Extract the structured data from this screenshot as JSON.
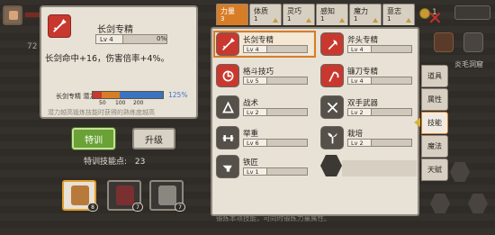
{
  "hud": {
    "level_text": "72",
    "gold_text": "1",
    "right_note": "炎毛洞窟"
  },
  "detail": {
    "title": "长剑专精",
    "level": "Lv 4",
    "progress_pct": "0%",
    "description": "长剑命中+16，伤害倍率+4%。",
    "mastery_label": "长剑专精 潜力",
    "mastery_ticks": [
      "50",
      "100",
      "200"
    ],
    "mastery_pct": "125%",
    "mastery_note": "潜力越高锻炼技能时获得的熟练度越高",
    "icon": "sword-icon"
  },
  "buttons": {
    "train": "特训",
    "upgrade": "升级"
  },
  "skill_points": {
    "label": "特训技能点:",
    "value": "23"
  },
  "portraits": [
    {
      "badge": "8"
    },
    {
      "badge": "7"
    },
    {
      "badge": "7"
    }
  ],
  "tabs": [
    {
      "label": "力量",
      "count": "3",
      "active": true
    },
    {
      "label": "体质",
      "count": "1"
    },
    {
      "label": "灵巧",
      "count": "1"
    },
    {
      "label": "感知",
      "count": "1"
    },
    {
      "label": "魔力",
      "count": "1"
    },
    {
      "label": "意志",
      "count": "1"
    }
  ],
  "skills": [
    {
      "name": "长剑专精",
      "level": "Lv 4",
      "icon": "sword-icon",
      "color": "#c9382e"
    },
    {
      "name": "斧头专精",
      "level": "Lv 4",
      "icon": "axe-icon",
      "color": "#c9382e"
    },
    {
      "name": "格斗技巧",
      "level": "Lv 5",
      "icon": "fist-icon",
      "color": "#c9382e"
    },
    {
      "name": "镰刀专精",
      "level": "Lv 4",
      "icon": "scythe-icon",
      "color": "#c9382e"
    },
    {
      "name": "战术",
      "level": "Lv 2",
      "icon": "tactics-icon",
      "color": "#55504a"
    },
    {
      "name": "双手武器",
      "level": "Lv 2",
      "icon": "two-hand-weapon-icon",
      "color": "#55504a"
    },
    {
      "name": "举重",
      "level": "Lv 6",
      "icon": "weightlifting-icon",
      "color": "#55504a"
    },
    {
      "name": "栽培",
      "level": "Lv 2",
      "icon": "cultivation-icon",
      "color": "#55504a"
    },
    {
      "name": "铁匠",
      "level": "Lv 1",
      "icon": "anvil-icon",
      "color": "#55504a"
    }
  ],
  "side_tabs": [
    {
      "label": "道具"
    },
    {
      "label": "属性"
    },
    {
      "label": "技能",
      "active": true
    },
    {
      "label": "魔法"
    },
    {
      "label": "天赋"
    }
  ],
  "footer_note": "锻炼本项技能，可同时锻炼力量属性。"
}
